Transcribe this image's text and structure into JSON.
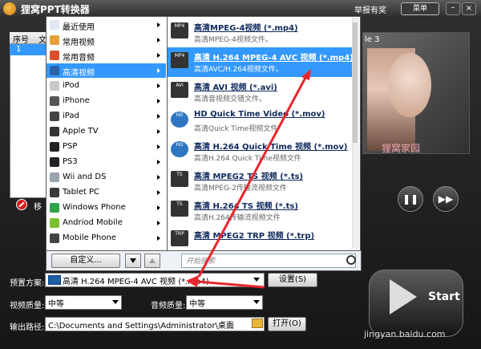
{
  "window": {
    "title": "狸窝PPT转换器",
    "report_link": "举报有奖",
    "menu_button": "菜单",
    "minimize": "–",
    "close": "×"
  },
  "file_list": {
    "col_num": "序号",
    "col_file": "文",
    "row_num": "1"
  },
  "status_text": "移",
  "preview": {
    "label": "le 3",
    "caption": "狸窝家园"
  },
  "menu": {
    "items": [
      {
        "label": "最近使用",
        "icon": "clock-icon",
        "color": "#e1e8f3"
      },
      {
        "label": "常用视频",
        "icon": "video-icon",
        "color": "#e3a23a"
      },
      {
        "label": "常用音频",
        "icon": "music-icon",
        "color": "#d9502a"
      },
      {
        "label": "高清视频",
        "icon": "hd-video-icon",
        "color": "#2c63a8"
      },
      {
        "label": "iPod",
        "icon": "ipod-icon",
        "color": "#c8c8c8"
      },
      {
        "label": "iPhone",
        "icon": "iphone-icon",
        "color": "#555555"
      },
      {
        "label": "iPad",
        "icon": "ipad-icon",
        "color": "#444444"
      },
      {
        "label": "Apple TV",
        "icon": "apple-tv-icon",
        "color": "#333333"
      },
      {
        "label": "PSP",
        "icon": "psp-icon",
        "color": "#222222"
      },
      {
        "label": "PS3",
        "icon": "ps3-icon",
        "color": "#222222"
      },
      {
        "label": "Wii and DS",
        "icon": "wii-icon",
        "color": "#9aa4b0"
      },
      {
        "label": "Tablet PC",
        "icon": "tablet-icon",
        "color": "#3a3a3a"
      },
      {
        "label": "Windows Phone",
        "icon": "windows-icon",
        "color": "#2fa34a"
      },
      {
        "label": "Andriod Mobile",
        "icon": "android-icon",
        "color": "#7cbf2c"
      },
      {
        "label": "Mobile Phone",
        "icon": "mobile-icon",
        "color": "#444444"
      }
    ],
    "selected_index": 3
  },
  "submenu": {
    "items": [
      {
        "title": "高清MPEG-4视频 (*.mp4)",
        "desc": "高清MPEG-4视频文件。",
        "badge": "MP4"
      },
      {
        "title": "高清 H.264 MPEG-4 AVC 视频 (*.mp4)",
        "desc": "高清AVC/H.264视频文件。",
        "badge": "MP4"
      },
      {
        "title": "高清 AVI 视频 (*.avi)",
        "desc": "高清音视频交错文件。",
        "badge": "AVI"
      },
      {
        "title": "HD Quick Time Video (*.mov)",
        "desc": "高清Quick Time视频文件",
        "badge": "HD"
      },
      {
        "title": "高清 H.264 Quick Time 视频 (*.mov)",
        "desc": "高清H.264 Quick Time视频文件",
        "badge": "HD"
      },
      {
        "title": "高清 MPEG2 TS 视频 (*.ts)",
        "desc": "高清MPEG-2传输流视频文件",
        "badge": "TS"
      },
      {
        "title": "高清 H.264 TS 视频 (*.ts)",
        "desc": "高清H.264传输流视频文件",
        "badge": "TS"
      },
      {
        "title": "高清 MPEG2 TRP 视频 (*.trp)",
        "desc": "",
        "badge": "TRP"
      }
    ],
    "selected_index": 1
  },
  "menu_footer": {
    "custom_button": "自定义...",
    "search_placeholder": "开始搜索"
  },
  "settings": {
    "preset_label": "预置方案:",
    "preset_value": "高清 H.264 MPEG-4 AVC 视频 (*.mp4)",
    "settings_button": "设置(S)",
    "video_quality_label": "视频质量:",
    "video_quality_value": "中等",
    "audio_quality_label": "音频质量:",
    "audio_quality_value": "中等",
    "output_label": "输出路径:",
    "output_value": "C:\\Documents and Settings\\Administrator\\桌面",
    "open_button": "打开(O)",
    "start_label": "Start"
  },
  "watermark": "jingyan.baidu.com",
  "colors": {
    "selection": "#3399ff",
    "annotation_arrow": "#e8262d"
  }
}
